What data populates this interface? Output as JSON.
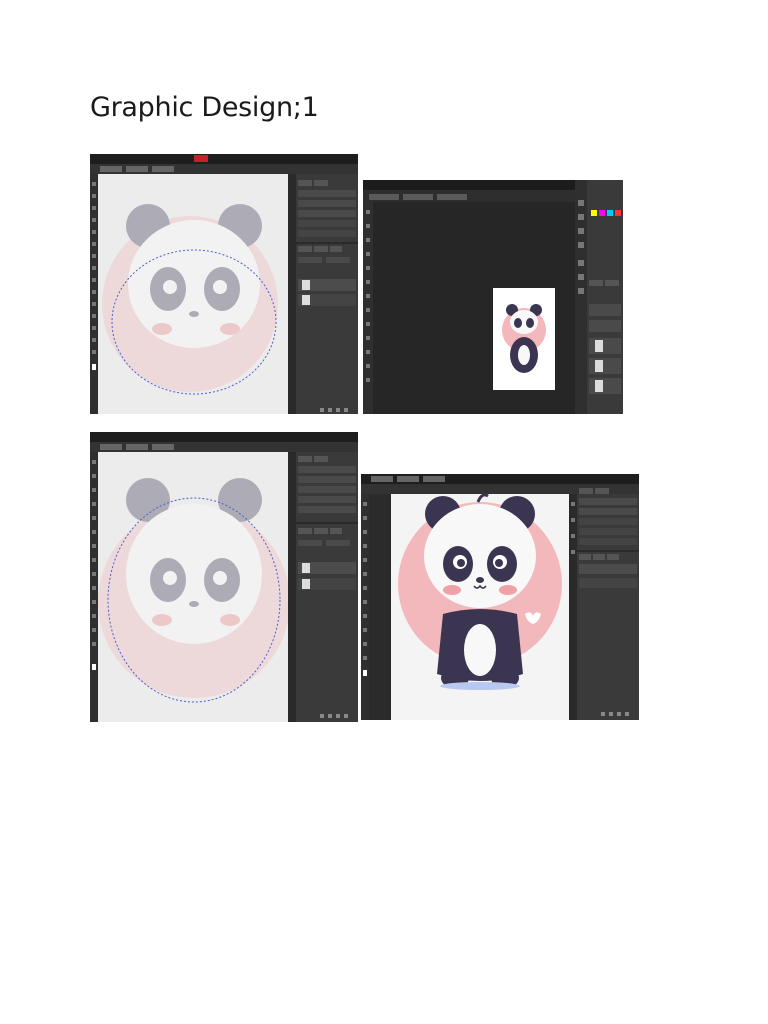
{
  "document": {
    "title": "Graphic Design;1"
  },
  "screenshots": [
    {
      "id": "shot-1",
      "theme": "dark",
      "canvas_state": "faded"
    },
    {
      "id": "shot-2",
      "theme": "dark",
      "canvas_state": "thumbnail"
    },
    {
      "id": "shot-3",
      "theme": "dark",
      "canvas_state": "faded"
    },
    {
      "id": "shot-4",
      "theme": "dark",
      "canvas_state": "full-color"
    }
  ],
  "colors": {
    "app_bg": "#2b2b2b",
    "panel_bg": "#3a3a3a",
    "toolbar_bg": "#1e1e1e",
    "selection_path": "#4a5fd0",
    "panda_dark": "#3b3552",
    "panda_pink": "#f2b8bb"
  },
  "icons": [
    "panda-illustration",
    "brush-icon",
    "swatch-icon",
    "layer-thumbnail-icon"
  ]
}
